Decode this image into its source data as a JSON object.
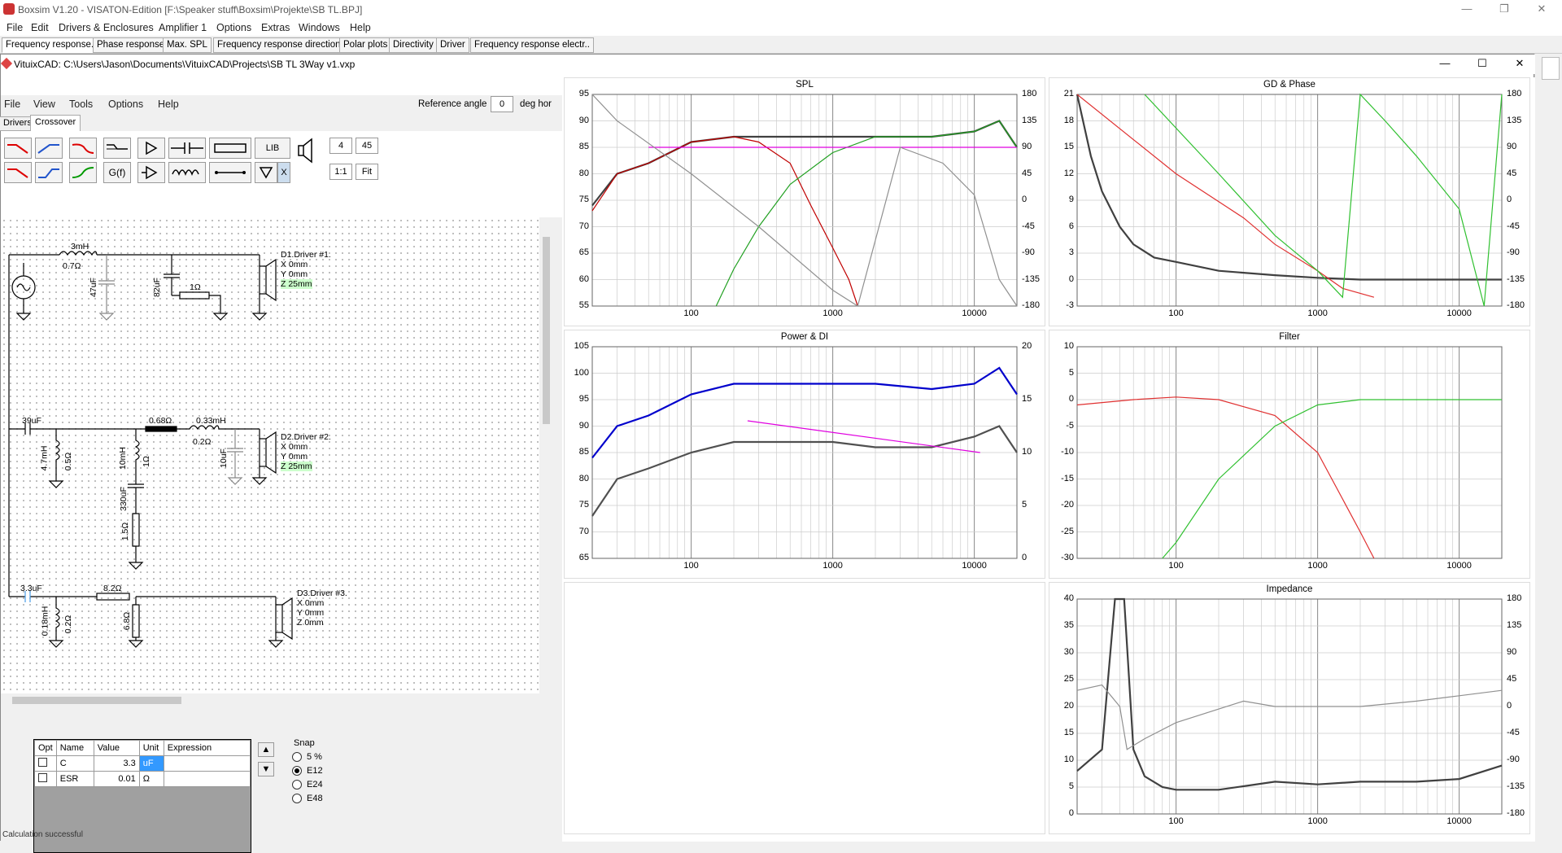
{
  "boxsim": {
    "title": "Boxsim V1.20 - VISATON-Edition [F:\\Speaker stuff\\Boxsim\\Projekte\\SB TL.BPJ]",
    "menu": [
      "File",
      "Edit",
      "Drivers & Enclosures",
      "Amplifier 1",
      "Options",
      "Extras",
      "Windows",
      "Help"
    ],
    "tabs": [
      "Frequency response.",
      "Phase response",
      "Max. SPL",
      "Frequency response directions",
      "Polar plots",
      "Directivity",
      "Driver",
      "Frequency response electr.."
    ],
    "win_controls": [
      "—",
      "❐",
      "✕"
    ]
  },
  "vituix": {
    "title": "VituixCAD: C:\\Users\\Jason\\Documents\\VituixCAD\\Projects\\SB TL 3Way v1.vxp",
    "menu": [
      "File",
      "View",
      "Tools",
      "Options",
      "Help"
    ],
    "ref_angle_label": "Reference angle",
    "ref_angle_value": "0",
    "ref_angle_unit": "deg hor",
    "tabs": [
      "Drivers",
      "Crossover"
    ],
    "toolbar_text": {
      "lib": "LIB",
      "gf": "G(f)",
      "x": "X",
      "n4": "4",
      "n45": "45",
      "one": "1:1",
      "fit": "Fit"
    },
    "win_controls": [
      "—",
      "☐",
      "✕"
    ],
    "schematic": {
      "d1": {
        "name": "D1.Driver #1.",
        "x": "X 0mm",
        "y": "Y 0mm",
        "z": "Z 25mm"
      },
      "d2": {
        "name": "D2.Driver #2.",
        "x": "X 0mm",
        "y": "Y 0mm",
        "z": "Z 25mm"
      },
      "d3": {
        "name": "D3.Driver #3.",
        "x": "X 0mm",
        "y": "Y 0mm",
        "z": "Z 0mm"
      },
      "labels": {
        "l1": "3mH",
        "r1": "0.7Ω",
        "c1": "47uF",
        "c2": "82uF",
        "r2": "1Ω",
        "c3": "39uF",
        "r3": "0.68Ω",
        "l3": "0.33mH",
        "r4": "0.2Ω",
        "l2": "4.7mH",
        "r5": "0.5Ω",
        "l4": "10mH",
        "r6": "1Ω",
        "c4": "10uF",
        "c5": "330uF",
        "r7": "1.5Ω",
        "c6": "3.3uF",
        "r8": "8.2Ω",
        "l5": "0.18mH",
        "r9": "0.2Ω",
        "r10": "6.8Ω"
      }
    },
    "params": {
      "headers": [
        "Opt",
        "Name",
        "Value",
        "Unit",
        "Expression"
      ],
      "rows": [
        {
          "name": "C",
          "value": "3.3",
          "unit": "uF",
          "expr": ""
        },
        {
          "name": "ESR",
          "value": "0.01",
          "unit": "Ω",
          "expr": ""
        }
      ]
    },
    "snap": {
      "label": "Snap",
      "options": [
        "5 %",
        "E12",
        "E24",
        "E48"
      ],
      "selected": "E12"
    },
    "status": "Calculation successful"
  },
  "charts": [
    {
      "title": "SPL",
      "xticks": [
        "100",
        "1000",
        "10000"
      ],
      "yleft": [
        "95",
        "90",
        "85",
        "80",
        "75",
        "70",
        "65",
        "60",
        "55"
      ],
      "yright": [
        "180",
        "135",
        "90",
        "45",
        "0",
        "-45",
        "-90",
        "-135",
        "-180"
      ]
    },
    {
      "title": "GD & Phase",
      "xticks": [
        "100",
        "1000",
        "10000"
      ],
      "yleft": [
        "21",
        "18",
        "15",
        "12",
        "9",
        "6",
        "3",
        "0",
        "-3"
      ],
      "yright": [
        "180",
        "135",
        "90",
        "45",
        "0",
        "-45",
        "-90",
        "-135",
        "-180"
      ]
    },
    {
      "title": "Power & DI",
      "xticks": [
        "100",
        "1000",
        "10000"
      ],
      "yleft": [
        "105",
        "100",
        "95",
        "90",
        "85",
        "80",
        "75",
        "70",
        "65"
      ],
      "yright": [
        "20",
        "",
        "15",
        "",
        "10",
        "",
        "5",
        "",
        "0"
      ]
    },
    {
      "title": "Filter",
      "xticks": [
        "100",
        "1000",
        "10000"
      ],
      "yleft": [
        "10",
        "5",
        "0",
        "-5",
        "-10",
        "-15",
        "-20",
        "-25",
        "-30"
      ],
      "yright": []
    },
    {
      "title": "Impedance",
      "xticks": [
        "100",
        "1000",
        "10000"
      ],
      "yleft": [
        "40",
        "35",
        "30",
        "25",
        "20",
        "15",
        "10",
        "5",
        "0"
      ],
      "yright": [
        "180",
        "135",
        "90",
        "45",
        "0",
        "-45",
        "-90",
        "-135",
        "-180"
      ]
    }
  ],
  "chart_data": [
    {
      "type": "line",
      "title": "SPL",
      "xlabel": "",
      "ylabel": "",
      "xscale": "log",
      "xlim": [
        20,
        20000
      ],
      "ylim": [
        55,
        95
      ],
      "grid": true,
      "series": [
        {
          "color": "#404040",
          "x": [
            20,
            30,
            50,
            100,
            200,
            300,
            500,
            1000,
            2000,
            5000,
            10000,
            15000,
            20000
          ],
          "y": [
            74,
            80,
            82,
            86,
            87,
            87,
            87,
            87,
            87,
            87,
            88,
            90,
            85
          ]
        },
        {
          "color": "#c00000",
          "x": [
            20,
            30,
            50,
            100,
            200,
            300,
            500,
            700,
            1000,
            1300,
            1500
          ],
          "y": [
            73,
            80,
            82,
            86,
            87,
            86,
            82,
            74,
            66,
            60,
            55
          ]
        },
        {
          "color": "#20a020",
          "x": [
            150,
            200,
            300,
            500,
            1000,
            2000,
            5000,
            10000,
            15000,
            20000
          ],
          "y": [
            55,
            62,
            70,
            78,
            84,
            87,
            87,
            88,
            90,
            85
          ]
        },
        {
          "color": "#e000e0",
          "x": [
            50,
            20000
          ],
          "y": [
            85,
            85
          ]
        },
        {
          "color": "#909090",
          "x": [
            20,
            30,
            100,
            300,
            1000,
            1500,
            3000,
            6000,
            10000,
            15000,
            20000
          ],
          "y": [
            95,
            90,
            80,
            70,
            58,
            55,
            85,
            82,
            76,
            60,
            55
          ]
        }
      ]
    },
    {
      "type": "line",
      "title": "GD & Phase",
      "xscale": "log",
      "xlim": [
        20,
        20000
      ],
      "ylim": [
        -3,
        21
      ],
      "grid": true,
      "series": [
        {
          "color": "#404040",
          "x": [
            20,
            25,
            30,
            40,
            50,
            70,
            100,
            200,
            500,
            1000,
            2000,
            5000,
            10000,
            20000
          ],
          "y": [
            21,
            14,
            10,
            6,
            4,
            2.5,
            2,
            1,
            0.5,
            0.2,
            0,
            0,
            0,
            0
          ]
        },
        {
          "color": "#e03030",
          "x": [
            20,
            100,
            300,
            500,
            1000,
            1500,
            2500
          ],
          "y": [
            21,
            12,
            7,
            4,
            1,
            -1,
            -2
          ]
        },
        {
          "color": "#30c030",
          "x": [
            60,
            200,
            500,
            1000,
            1500,
            2000,
            3000,
            5000,
            10000,
            15000,
            20000
          ],
          "y": [
            21,
            12,
            5,
            1,
            -2,
            21,
            18,
            14,
            8,
            -3,
            21
          ]
        }
      ]
    },
    {
      "type": "line",
      "title": "Power & DI",
      "xscale": "log",
      "xlim": [
        20,
        20000
      ],
      "ylim": [
        65,
        105
      ],
      "grid": true,
      "series": [
        {
          "color": "#0000cc",
          "x": [
            20,
            30,
            50,
            100,
            200,
            500,
            1000,
            2000,
            5000,
            10000,
            15000,
            20000
          ],
          "y": [
            84,
            90,
            92,
            96,
            98,
            98,
            98,
            98,
            97,
            98,
            101,
            96
          ]
        },
        {
          "color": "#505050",
          "x": [
            20,
            30,
            50,
            100,
            200,
            500,
            1000,
            2000,
            5000,
            10000,
            15000,
            20000
          ],
          "y": [
            73,
            80,
            82,
            85,
            87,
            87,
            87,
            86,
            86,
            88,
            90,
            85
          ]
        },
        {
          "color": "#e000e0",
          "x": [
            250,
            11000
          ],
          "y": [
            91,
            85
          ]
        }
      ]
    },
    {
      "type": "line",
      "title": "Filter",
      "xscale": "log",
      "xlim": [
        20,
        20000
      ],
      "ylim": [
        -30,
        10
      ],
      "grid": true,
      "series": [
        {
          "color": "#e03030",
          "x": [
            20,
            50,
            100,
            200,
            500,
            1000,
            2000,
            2500
          ],
          "y": [
            -1,
            0,
            0.5,
            0,
            -3,
            -10,
            -25,
            -30
          ]
        },
        {
          "color": "#30c030",
          "x": [
            80,
            100,
            200,
            500,
            1000,
            2000,
            5000,
            20000
          ],
          "y": [
            -30,
            -27,
            -15,
            -5,
            -1,
            0,
            0,
            0
          ]
        }
      ]
    },
    {
      "type": "line",
      "title": "Impedance",
      "xscale": "log",
      "xlim": [
        20,
        20000
      ],
      "ylim": [
        0,
        40
      ],
      "grid": true,
      "series": [
        {
          "color": "#404040",
          "x": [
            20,
            30,
            37,
            40,
            43,
            50,
            60,
            80,
            100,
            200,
            500,
            1000,
            2000,
            5000,
            10000,
            20000
          ],
          "y": [
            8,
            12,
            40,
            45,
            40,
            12,
            7,
            5,
            4.5,
            4.5,
            6,
            5.5,
            6,
            6,
            6.5,
            9
          ]
        },
        {
          "color": "#909090",
          "x": [
            20,
            30,
            40,
            45,
            60,
            100,
            300,
            500,
            1000,
            2000,
            5000,
            10000,
            20000
          ],
          "y": [
            23,
            24,
            20,
            12,
            14,
            17,
            21,
            20,
            20,
            20,
            21,
            22,
            23
          ]
        }
      ]
    }
  ]
}
